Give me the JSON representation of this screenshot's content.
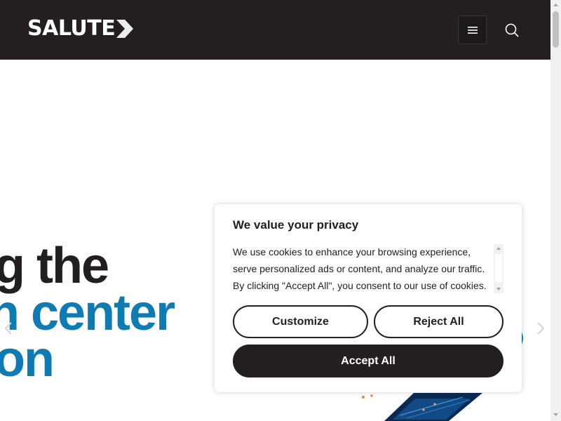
{
  "header": {
    "logo_text": "SALUTE",
    "menu_icon": "hamburger-icon",
    "search_icon": "search-icon"
  },
  "hero": {
    "line1": "g the",
    "line2": "n center",
    "line3": "on"
  },
  "cookie_banner": {
    "title": "We value your privacy",
    "body": "We use cookies to enhance your browsing experience, serve personalized ads or content, and analyze our traffic. By clicking \"Accept All\", you consent to our use of cookies.",
    "customize_label": "Customize",
    "reject_label": "Reject All",
    "accept_label": "Accept All"
  },
  "colors": {
    "header_bg": "#231f20",
    "accent_blue": "#0f7bb3",
    "dark_text": "#231f20"
  }
}
